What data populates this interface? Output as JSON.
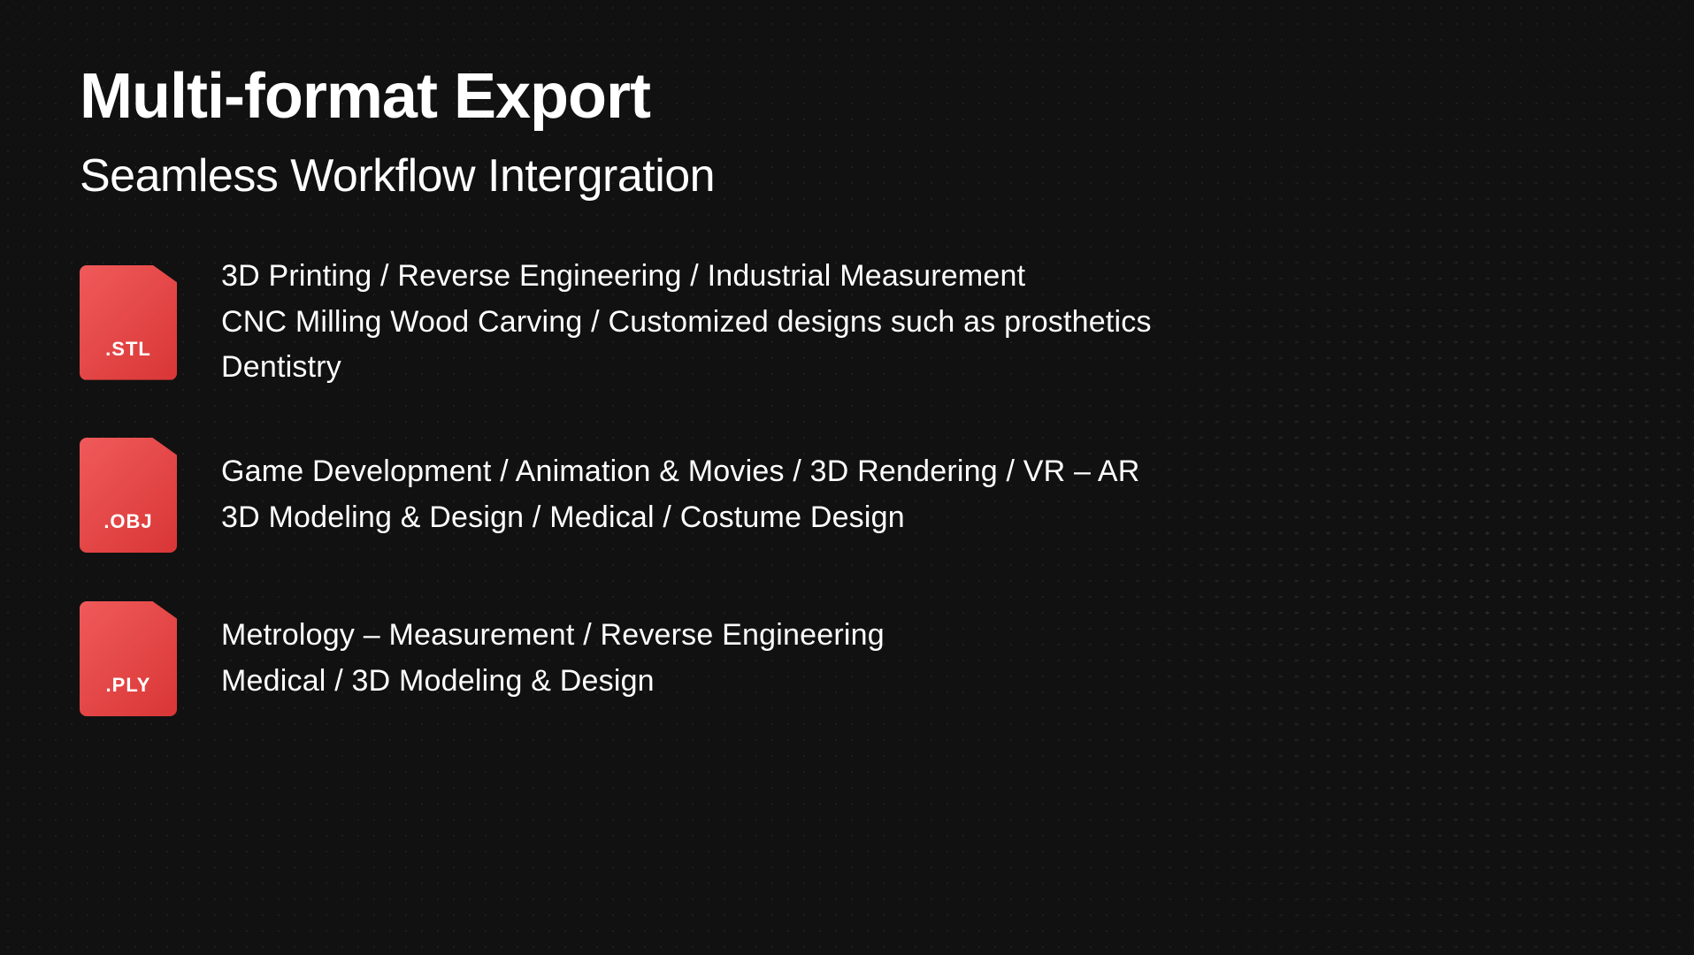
{
  "page": {
    "main_title": "Multi-format Export",
    "subtitle": "Seamless Workflow Intergration",
    "background_color": "#111111",
    "accent_color": "#e84040"
  },
  "formats": [
    {
      "extension": ".STL",
      "description_line1": "3D Printing / Reverse Engineering / Industrial Measurement",
      "description_line2": "CNC Milling Wood Carving / Customized designs such as prosthetics",
      "description_line3": "Dentistry"
    },
    {
      "extension": ".OBJ",
      "description_line1": "Game Development / Animation & Movies / 3D Rendering / VR – AR",
      "description_line2": "3D Modeling & Design / Medical / Costume Design",
      "description_line3": ""
    },
    {
      "extension": ".PLY",
      "description_line1": "Metrology – Measurement / Reverse Engineering",
      "description_line2": "Medical / 3D Modeling & Design",
      "description_line3": ""
    }
  ]
}
